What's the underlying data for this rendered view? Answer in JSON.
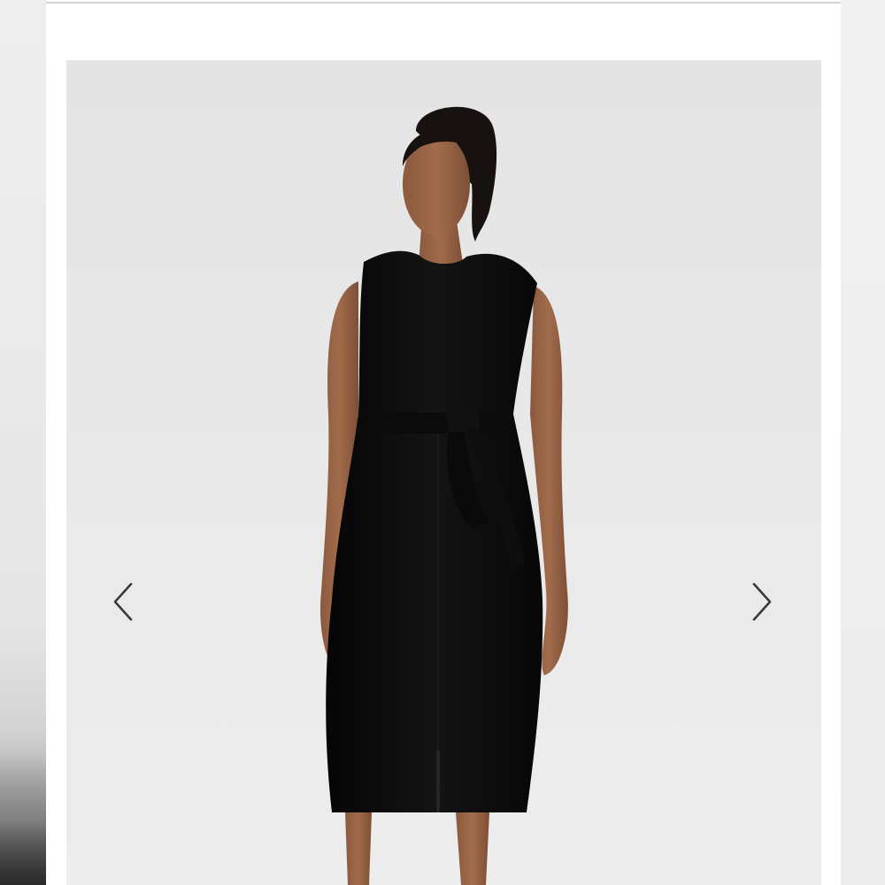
{
  "gallery": {
    "prev_icon": "chevron-left-icon",
    "next_icon": "chevron-right-icon",
    "image_subject": "woman-black-sleeveless-belted-dress"
  },
  "colors": {
    "background": "#e8e8e8",
    "dress": "#0d0d0d",
    "arrow": "#3a3a3a"
  }
}
